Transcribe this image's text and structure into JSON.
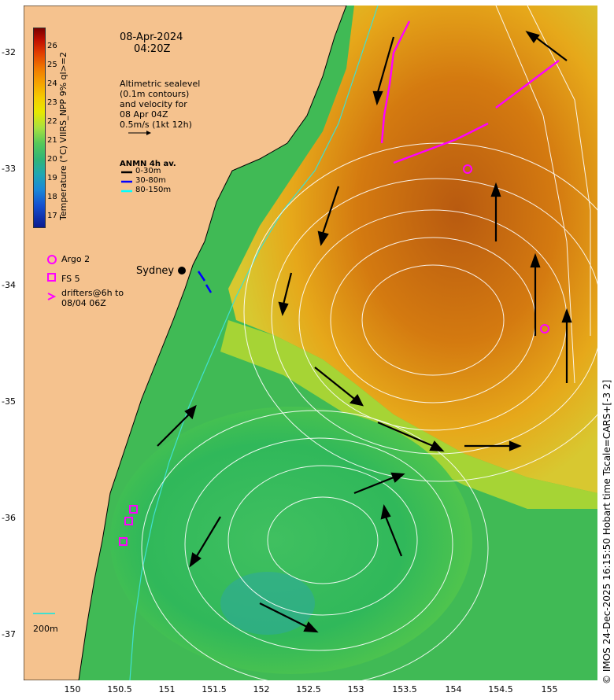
{
  "header": {
    "date": "08-Apr-2024",
    "time": "04:20Z"
  },
  "info_lines": [
    "Altimetric sealevel",
    "(0.1m contours)",
    "and velocity for",
    "08 Apr 04Z",
    "0.5m/s (1kt 12h)"
  ],
  "anmn": {
    "title": "ANMN 4h av.",
    "rows": [
      {
        "label": "0-30m",
        "color": "#000000"
      },
      {
        "label": "30-80m",
        "color": "#0000ff"
      },
      {
        "label": "80-150m",
        "color": "#00ffff"
      }
    ]
  },
  "legend": {
    "argo": "Argo 2",
    "fs": "FS 5",
    "drifters_1": "drifters@6h to",
    "drifters_2": "08/04 06Z",
    "symbol_color": "#ff00ff"
  },
  "places": {
    "sydney": "Sydney",
    "scale_200m": "200m"
  },
  "colorbar": {
    "label": "Temperature (°C) VIIRS_NPP 9% ql>=2",
    "ticks": [
      "26",
      "25",
      "24",
      "23",
      "22",
      "21",
      "20",
      "19",
      "18",
      "17"
    ]
  },
  "axes": {
    "y_ticks": [
      "-32",
      "-33",
      "-34",
      "-35",
      "-36",
      "-37"
    ],
    "x_ticks": [
      "150",
      "150.5",
      "151",
      "151.5",
      "152",
      "152.5",
      "153",
      "153.5",
      "154",
      "154.5",
      "155"
    ],
    "x_range": [
      149.5,
      155.5
    ],
    "y_range": [
      -37.4,
      -31.7
    ]
  },
  "credit": "© IMOS 24-Dec-2025 16:15:50 Hobart time Tscale=CARS+[-3 2]",
  "colors": {
    "land": "#f5c28e",
    "warm": "#c05a10",
    "cool": "#2fb850",
    "contour": "#ffffff",
    "coast_200m": "#40e0d0"
  }
}
